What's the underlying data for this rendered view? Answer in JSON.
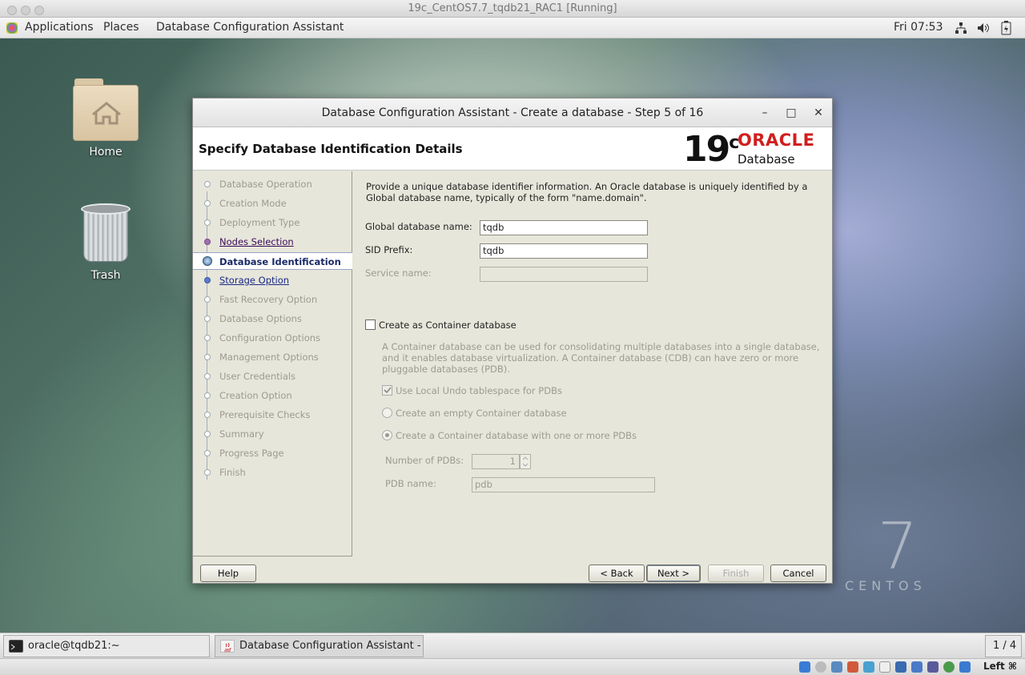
{
  "vm_title": "19c_CentOS7.7_tqdb21_RAC1 [Running]",
  "topbar": {
    "applications": "Applications",
    "places": "Places",
    "app": "Database Configuration Assistant",
    "clock": "Fri 07:53"
  },
  "desktop": {
    "home": "Home",
    "trash": "Trash",
    "logo_number": "7",
    "logo_word": "CENTOS"
  },
  "dialog": {
    "title": "Database Configuration Assistant - Create a database - Step 5 of 16",
    "minimize": "–",
    "maximize": "□",
    "close": "✕",
    "header": "Specify Database Identification Details",
    "logo_version": "19",
    "logo_version_sup": "c",
    "logo_brand": "ORACLE",
    "logo_product": "Database",
    "steps": [
      "Database Operation",
      "Creation Mode",
      "Deployment Type",
      "Nodes Selection",
      "Database Identification",
      "Storage Option",
      "Fast Recovery Option",
      "Database Options",
      "Configuration Options",
      "Management Options",
      "User Credentials",
      "Creation Option",
      "Prerequisite Checks",
      "Summary",
      "Progress Page",
      "Finish"
    ],
    "intro": "Provide a unique database identifier information. An Oracle database is uniquely identified by a Global database name, typically of the form \"name.domain\".",
    "global_name_label": "Global database name:",
    "global_name_value": "tqdb",
    "sid_label": "SID Prefix:",
    "sid_value": "tqdb",
    "service_label": "Service name:",
    "service_value": "",
    "cdb_label": "Create as Container database",
    "cdb_desc": "A Container database can be used for consolidating multiple databases into a single database, and it enables database virtualization. A Container database (CDB) can have zero or more pluggable databases (PDB).",
    "undo_label": "Use Local Undo tablespace for PDBs",
    "empty_cdb_label": "Create an empty Container database",
    "pdbs_cdb_label": "Create a Container database with one or more PDBs",
    "num_pdbs_label": "Number of PDBs:",
    "num_pdbs_value": "1",
    "pdb_name_label": "PDB name:",
    "pdb_name_value": "pdb",
    "help": "Help",
    "back": "< Back",
    "next": "Next >",
    "finish": "Finish",
    "cancel": "Cancel"
  },
  "taskbar": {
    "terminal": "oracle@tqdb21:~",
    "dbca": "Database Configuration Assistant - C...",
    "workspace": "1 / 4"
  },
  "vbox": {
    "host_key": "Left ⌘"
  }
}
